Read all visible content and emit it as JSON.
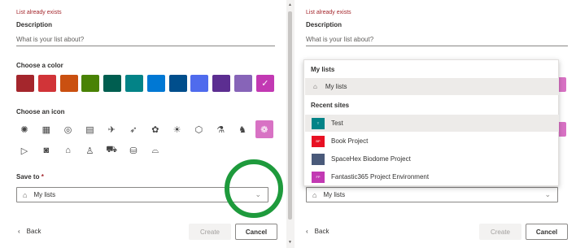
{
  "form": {
    "error_text": "List already exists",
    "description_label": "Description",
    "description_placeholder": "What is your list about?",
    "color_label": "Choose a color",
    "icon_label": "Choose an icon",
    "save_to_label": "Save to",
    "required_marker": "*",
    "save_to_value": "My lists",
    "back_label": "Back",
    "create_label": "Create",
    "cancel_label": "Cancel"
  },
  "colors": [
    "#a4262c",
    "#d13438",
    "#ca5010",
    "#498205",
    "#005e50",
    "#038387",
    "#0078d4",
    "#004e8c",
    "#4f6bed",
    "#5c2e91",
    "#8764b8",
    "#c239b3"
  ],
  "selected_color_index": 11,
  "icons": [
    "bug-icon",
    "calendar-icon",
    "target-icon",
    "clipboard-icon",
    "plane-icon",
    "rocket-icon",
    "palette-icon",
    "lightbulb-icon",
    "cube-icon",
    "flask-icon",
    "robot-icon",
    "piggy-bank-icon",
    "play-icon",
    "camera-icon",
    "bank-icon",
    "person-icon",
    "car-icon",
    "cart-icon",
    "cake-icon"
  ],
  "icon_glyphs": [
    "✺",
    "▦",
    "◎",
    "▤",
    "✈",
    "➶",
    "✿",
    "☀",
    "⬡",
    "⚗",
    "♞",
    "❁",
    "▷",
    "◙",
    "⌂",
    "♙",
    "⛟",
    "⛁",
    "⌓"
  ],
  "selected_icon_index": 11,
  "dropdown": {
    "my_lists_header": "My lists",
    "my_lists_item": "My lists",
    "recent_header": "Recent sites",
    "sites": [
      {
        "name": "Test",
        "abbr": "T",
        "color": "#038387"
      },
      {
        "name": "Book Project",
        "abbr": "BP",
        "color": "#e81123"
      },
      {
        "name": "SpaceHex Biodome Project",
        "abbr": "",
        "color": "#4a5a7a"
      },
      {
        "name": "Fantastic365 Project Environment",
        "abbr": "FP",
        "color": "#c239b3"
      }
    ]
  },
  "colors_meta": {
    "highlight_circle": "#1e9a3c",
    "selected_accent": "#d872c4"
  }
}
